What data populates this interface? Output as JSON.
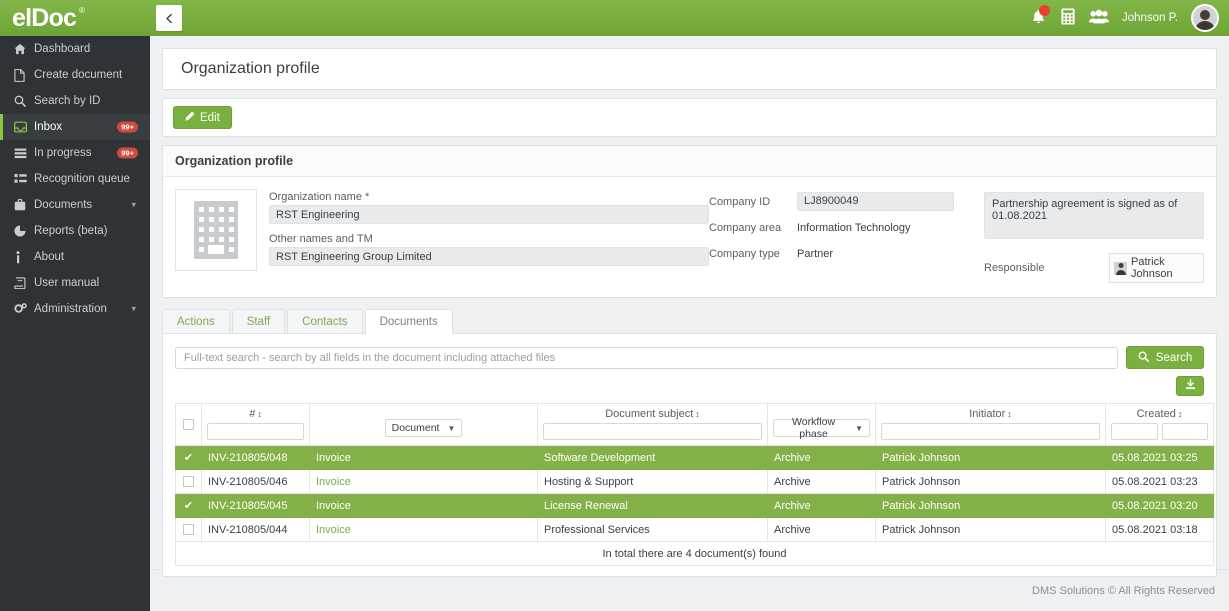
{
  "app": {
    "logo": "elDoc",
    "logo_tm": "®",
    "collapse_icon": "chevron-left-icon"
  },
  "header": {
    "notifications_icon": "bell-icon",
    "calculator_icon": "calculator-icon",
    "people_icon": "people-icon",
    "user_name": "Johnson P.",
    "avatar_icon": "user-avatar"
  },
  "sidebar": {
    "items": [
      {
        "label": "Dashboard",
        "icon": "home-icon",
        "badge": null,
        "caret": false,
        "active": false
      },
      {
        "label": "Create document",
        "icon": "file-icon",
        "badge": null,
        "caret": false,
        "active": false
      },
      {
        "label": "Search by ID",
        "icon": "search-icon",
        "badge": null,
        "caret": false,
        "active": false
      },
      {
        "label": "Inbox",
        "icon": "inbox-icon",
        "badge": "99+",
        "caret": false,
        "active": true
      },
      {
        "label": "In progress",
        "icon": "progress-icon",
        "badge": "99+",
        "caret": false,
        "active": false
      },
      {
        "label": "Recognition queue",
        "icon": "list-icon",
        "badge": null,
        "caret": false,
        "active": false
      },
      {
        "label": "Documents",
        "icon": "briefcase-icon",
        "badge": null,
        "caret": true,
        "active": false
      },
      {
        "label": "Reports (beta)",
        "icon": "pie-chart-icon",
        "badge": null,
        "caret": false,
        "active": false
      },
      {
        "label": "About",
        "icon": "info-icon",
        "badge": null,
        "caret": false,
        "active": false
      },
      {
        "label": "User manual",
        "icon": "book-icon",
        "badge": null,
        "caret": false,
        "active": false
      },
      {
        "label": "Administration",
        "icon": "gears-icon",
        "badge": null,
        "caret": true,
        "active": false
      }
    ]
  },
  "page": {
    "title": "Organization profile",
    "edit_label": "Edit",
    "edit_icon": "pencil-icon"
  },
  "profile": {
    "section_title": "Organization profile",
    "logo_icon": "building-icon",
    "org_name_label": "Organization name *",
    "org_name_value": "RST Engineering",
    "other_names_label": "Other names and TM",
    "other_names_value": "RST Engineering Group Limited",
    "company_id_label": "Company ID",
    "company_id_value": "LJ8900049",
    "company_area_label": "Company area",
    "company_area_value": "Information Technology",
    "company_type_label": "Company type",
    "company_type_value": "Partner",
    "note_value": "Partnership agreement is signed as of 01.08.2021",
    "responsible_label": "Responsible",
    "responsible_value": "Patrick Johnson",
    "responsible_avatar_icon": "user-avatar"
  },
  "tabs": [
    {
      "label": "Actions",
      "active": false
    },
    {
      "label": "Staff",
      "active": false
    },
    {
      "label": "Contacts",
      "active": false
    },
    {
      "label": "Documents",
      "active": true
    }
  ],
  "search": {
    "placeholder": "Full-text search - search by all fields in the document including attached files",
    "value": "",
    "button_label": "Search",
    "button_icon": "search-icon",
    "export_icon": "download-icon"
  },
  "table": {
    "columns": [
      {
        "key": "check",
        "title": "",
        "sortable": false,
        "filter": "checkbox"
      },
      {
        "key": "number",
        "title": "#",
        "sortable": true,
        "filter": "text",
        "filter_value": ""
      },
      {
        "key": "document",
        "title": "",
        "sortable": false,
        "filter": "dropdown",
        "filter_value": "Document"
      },
      {
        "key": "subject",
        "title": "Document subject",
        "sortable": true,
        "filter": "text",
        "filter_value": ""
      },
      {
        "key": "phase",
        "title": "",
        "sortable": false,
        "filter": "dropdown",
        "filter_value": "Workflow phase"
      },
      {
        "key": "initiator",
        "title": "Initiator",
        "sortable": true,
        "filter": "text",
        "filter_value": ""
      },
      {
        "key": "created",
        "title": "Created",
        "sortable": true,
        "filter": "text2",
        "filter_value": ""
      }
    ],
    "rows": [
      {
        "selected": true,
        "number": "INV-210805/048",
        "document": "Invoice",
        "subject": "Software Development",
        "phase": "Archive",
        "initiator": "Patrick Johnson",
        "created": "05.08.2021 03:25"
      },
      {
        "selected": false,
        "number": "INV-210805/046",
        "document": "Invoice",
        "subject": "Hosting & Support",
        "phase": "Archive",
        "initiator": "Patrick Johnson",
        "created": "05.08.2021 03:23"
      },
      {
        "selected": true,
        "number": "INV-210805/045",
        "document": "Invoice",
        "subject": "License Renewal",
        "phase": "Archive",
        "initiator": "Patrick Johnson",
        "created": "05.08.2021 03:20"
      },
      {
        "selected": false,
        "number": "INV-210805/044",
        "document": "Invoice",
        "subject": "Professional Services",
        "phase": "Archive",
        "initiator": "Patrick Johnson",
        "created": "05.08.2021 03:18"
      }
    ],
    "total_text": "In total there are 4 document(s) found"
  },
  "footer": {
    "copyright": "DMS Solutions © All Rights Reserved"
  },
  "colors": {
    "brand_green": "#7ab03f",
    "header_green": "#76ad3b",
    "row_selected": "#84b048",
    "sidebar_bg": "#2f3337",
    "badge_red": "#cf4a3f",
    "link_green": "#7ea94d"
  }
}
